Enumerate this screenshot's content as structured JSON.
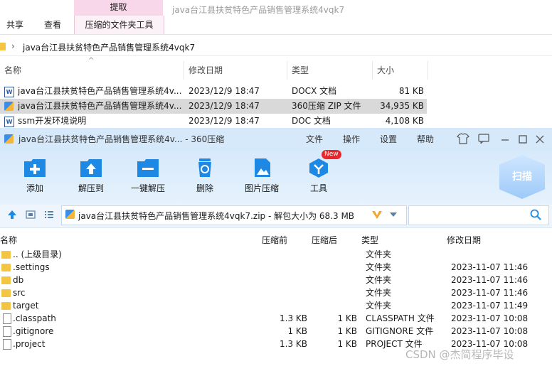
{
  "explorer": {
    "ribbon": {
      "tab_share": "共享",
      "tab_view": "查看",
      "context_header": "提取",
      "context_tab": "压缩的文件夹工具",
      "window_title": "java台江县扶贫特色产品销售管理系统4vqk7"
    },
    "address": {
      "path": "java台江县扶贫特色产品销售管理系统4vqk7"
    },
    "columns": {
      "name": "名称",
      "modified": "修改日期",
      "type": "类型",
      "size": "大小"
    },
    "files": [
      {
        "name": "java台江县扶贫特色产品销售管理系统4v...",
        "modified": "2023/12/9 18:47",
        "type": "DOCX 文档",
        "size": "81 KB",
        "icon": "word-doc-icon"
      },
      {
        "name": "java台江县扶贫特色产品销售管理系统4v...",
        "modified": "2023/12/9 18:47",
        "type": "360压缩 ZIP 文件",
        "size": "34,935 KB",
        "icon": "zip-file-icon"
      },
      {
        "name": "ssm开发环境说明",
        "modified": "2023/12/9 18:47",
        "type": "DOC 文档",
        "size": "4,108 KB",
        "icon": "word-doc-icon"
      }
    ]
  },
  "zip_window": {
    "title": "java台江县扶贫特色产品销售管理系统4v... - 360压缩",
    "menu": [
      "文件",
      "操作",
      "设置",
      "帮助"
    ],
    "toolbar": [
      {
        "label": "添加",
        "icon": "add-icon"
      },
      {
        "label": "解压到",
        "icon": "extract-to-icon"
      },
      {
        "label": "一键解压",
        "icon": "one-click-extract-icon"
      },
      {
        "label": "删除",
        "icon": "delete-icon"
      },
      {
        "label": "图片压缩",
        "icon": "image-compress-icon"
      },
      {
        "label": "工具",
        "icon": "tools-icon"
      }
    ],
    "new_badge": "New",
    "scan_label": "扫描",
    "path": "java台江县扶贫特色产品销售管理系统4vqk7.zip - 解包大小为 68.3 MB",
    "columns": {
      "name": "名称",
      "before": "压缩前",
      "after": "压缩后",
      "type": "类型",
      "modified": "修改日期"
    },
    "entries": [
      {
        "name": ".. (上级目录)",
        "before": "",
        "after": "",
        "type": "文件夹",
        "modified": "",
        "kind": "folder"
      },
      {
        "name": ".settings",
        "before": "",
        "after": "",
        "type": "文件夹",
        "modified": "2023-11-07 11:46",
        "kind": "folder"
      },
      {
        "name": "db",
        "before": "",
        "after": "",
        "type": "文件夹",
        "modified": "2023-11-07 11:46",
        "kind": "folder"
      },
      {
        "name": "src",
        "before": "",
        "after": "",
        "type": "文件夹",
        "modified": "2023-11-07 11:46",
        "kind": "folder"
      },
      {
        "name": "target",
        "before": "",
        "after": "",
        "type": "文件夹",
        "modified": "2023-11-07 11:49",
        "kind": "folder"
      },
      {
        "name": ".classpath",
        "before": "1.3 KB",
        "after": "1 KB",
        "type": "CLASSPATH 文件",
        "modified": "2023-11-07 10:08",
        "kind": "file"
      },
      {
        "name": ".gitignore",
        "before": "1 KB",
        "after": "1 KB",
        "type": "GITIGNORE 文件",
        "modified": "2023-11-07 10:08",
        "kind": "file"
      },
      {
        "name": ".project",
        "before": "1.3 KB",
        "after": "1 KB",
        "type": "PROJECT 文件",
        "modified": "2023-11-07 10:08",
        "kind": "file"
      }
    ]
  },
  "watermark": "CSDN @杰简程序毕设",
  "colors": {
    "accent": "#1e88e5",
    "title_bar": "#d6e9fb",
    "selection": "#d9d9d9"
  }
}
